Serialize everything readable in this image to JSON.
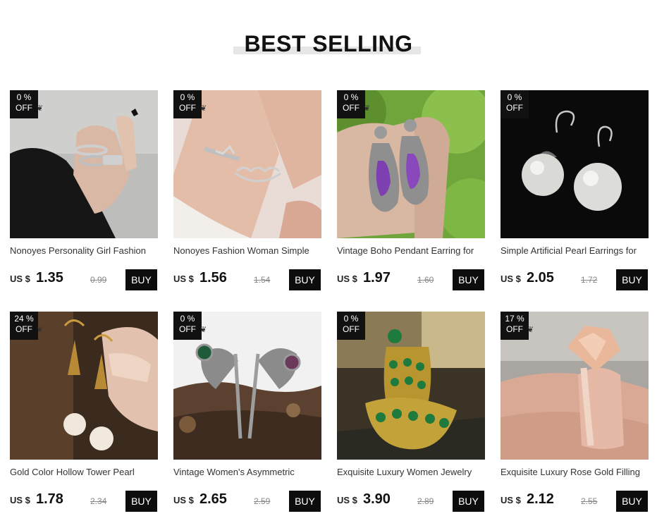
{
  "section": {
    "title": "BEST SELLING"
  },
  "products": [
    {
      "discount": "0  %",
      "off": "OFF",
      "name": "Nonoyes Personality Girl Fashion",
      "currency": "US $",
      "price": "1.35",
      "old_price": "0.99",
      "buy": "BUY"
    },
    {
      "discount": "0  %",
      "off": "OFF",
      "name": "Nonoyes Fashion Woman Simple",
      "currency": "US $",
      "price": "1.56",
      "old_price": "1.54",
      "buy": "BUY"
    },
    {
      "discount": "0  %",
      "off": "OFF",
      "name": "Vintage Boho Pendant Earring for",
      "currency": "US $",
      "price": "1.97",
      "old_price": "1.60",
      "buy": "BUY"
    },
    {
      "discount": "0  %",
      "off": "OFF",
      "name": "Simple Artificial Pearl Earrings for",
      "currency": "US $",
      "price": "2.05",
      "old_price": "1.72",
      "buy": "BUY"
    },
    {
      "discount": "24 %",
      "off": "OFF",
      "name": "Gold Color Hollow Tower Pearl",
      "currency": "US $",
      "price": "1.78",
      "old_price": "2.34",
      "buy": "BUY"
    },
    {
      "discount": "0  %",
      "off": "OFF",
      "name": "Vintage Women's Asymmetric",
      "currency": "US $",
      "price": "2.65",
      "old_price": "2.59",
      "buy": "BUY"
    },
    {
      "discount": "0  %",
      "off": "OFF",
      "name": "Exquisite Luxury Women Jewelry",
      "currency": "US $",
      "price": "3.90",
      "old_price": "2.89",
      "buy": "BUY"
    },
    {
      "discount": "17 %",
      "off": "OFF",
      "name": "Exquisite Luxury Rose Gold Filling",
      "currency": "US $",
      "price": "2.12",
      "old_price": "2.55",
      "buy": "BUY"
    }
  ]
}
